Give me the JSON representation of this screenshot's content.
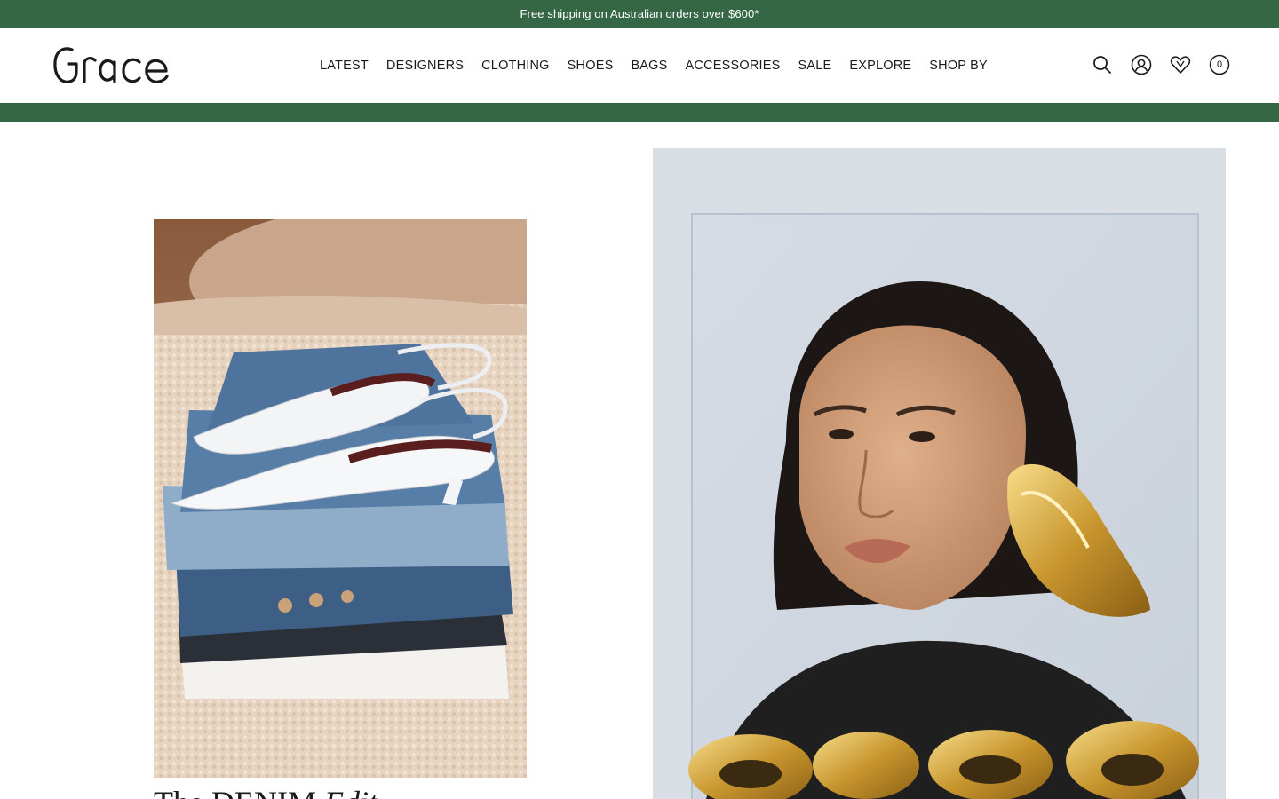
{
  "promo": {
    "text": "Free shipping on Australian orders over $600*"
  },
  "brand": {
    "logo_text": "Grace"
  },
  "nav": {
    "items": [
      "LATEST",
      "DESIGNERS",
      "CLOTHING",
      "SHOES",
      "BAGS",
      "ACCESSORIES",
      "SALE",
      "EXPLORE",
      "SHOP BY"
    ]
  },
  "header_icons": {
    "search": "search-icon",
    "account": "account-icon",
    "wishlist": "heart-icon",
    "bag": "bag-icon",
    "bag_count": "0"
  },
  "editorial": {
    "left_title_plain": "The DENIM ",
    "left_title_italic": "Edit"
  },
  "colors": {
    "brand_green": "#356745",
    "text": "#1a1a1a"
  }
}
